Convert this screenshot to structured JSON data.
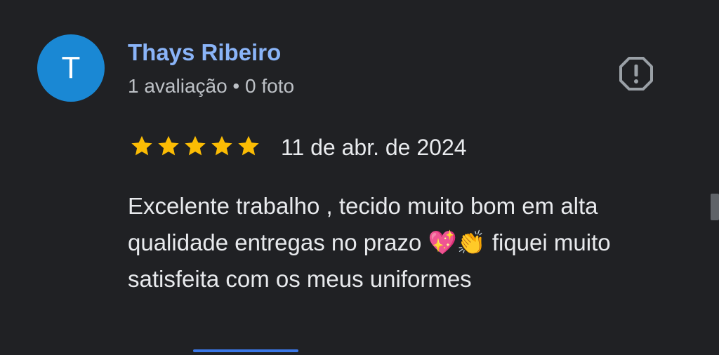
{
  "reviewer": {
    "avatar_initial": "T",
    "name": "Thays Ribeiro",
    "meta": "1 avaliação • 0 foto"
  },
  "review": {
    "rating": 5,
    "rating_max": 5,
    "date": "11 de abr. de 2024",
    "text": "Excelente trabalho , tecido muito bom em alta qualidade entregas no prazo 💖👏 fiquei muito satisfeita com os meus uniformes"
  },
  "icons": {
    "report": "report-flag-icon",
    "star": "star-icon"
  },
  "colors": {
    "background": "#202124",
    "avatar": "#1a88d4",
    "name": "#8ab4f8",
    "star": "#fbbc04",
    "text": "#e8eaed"
  }
}
